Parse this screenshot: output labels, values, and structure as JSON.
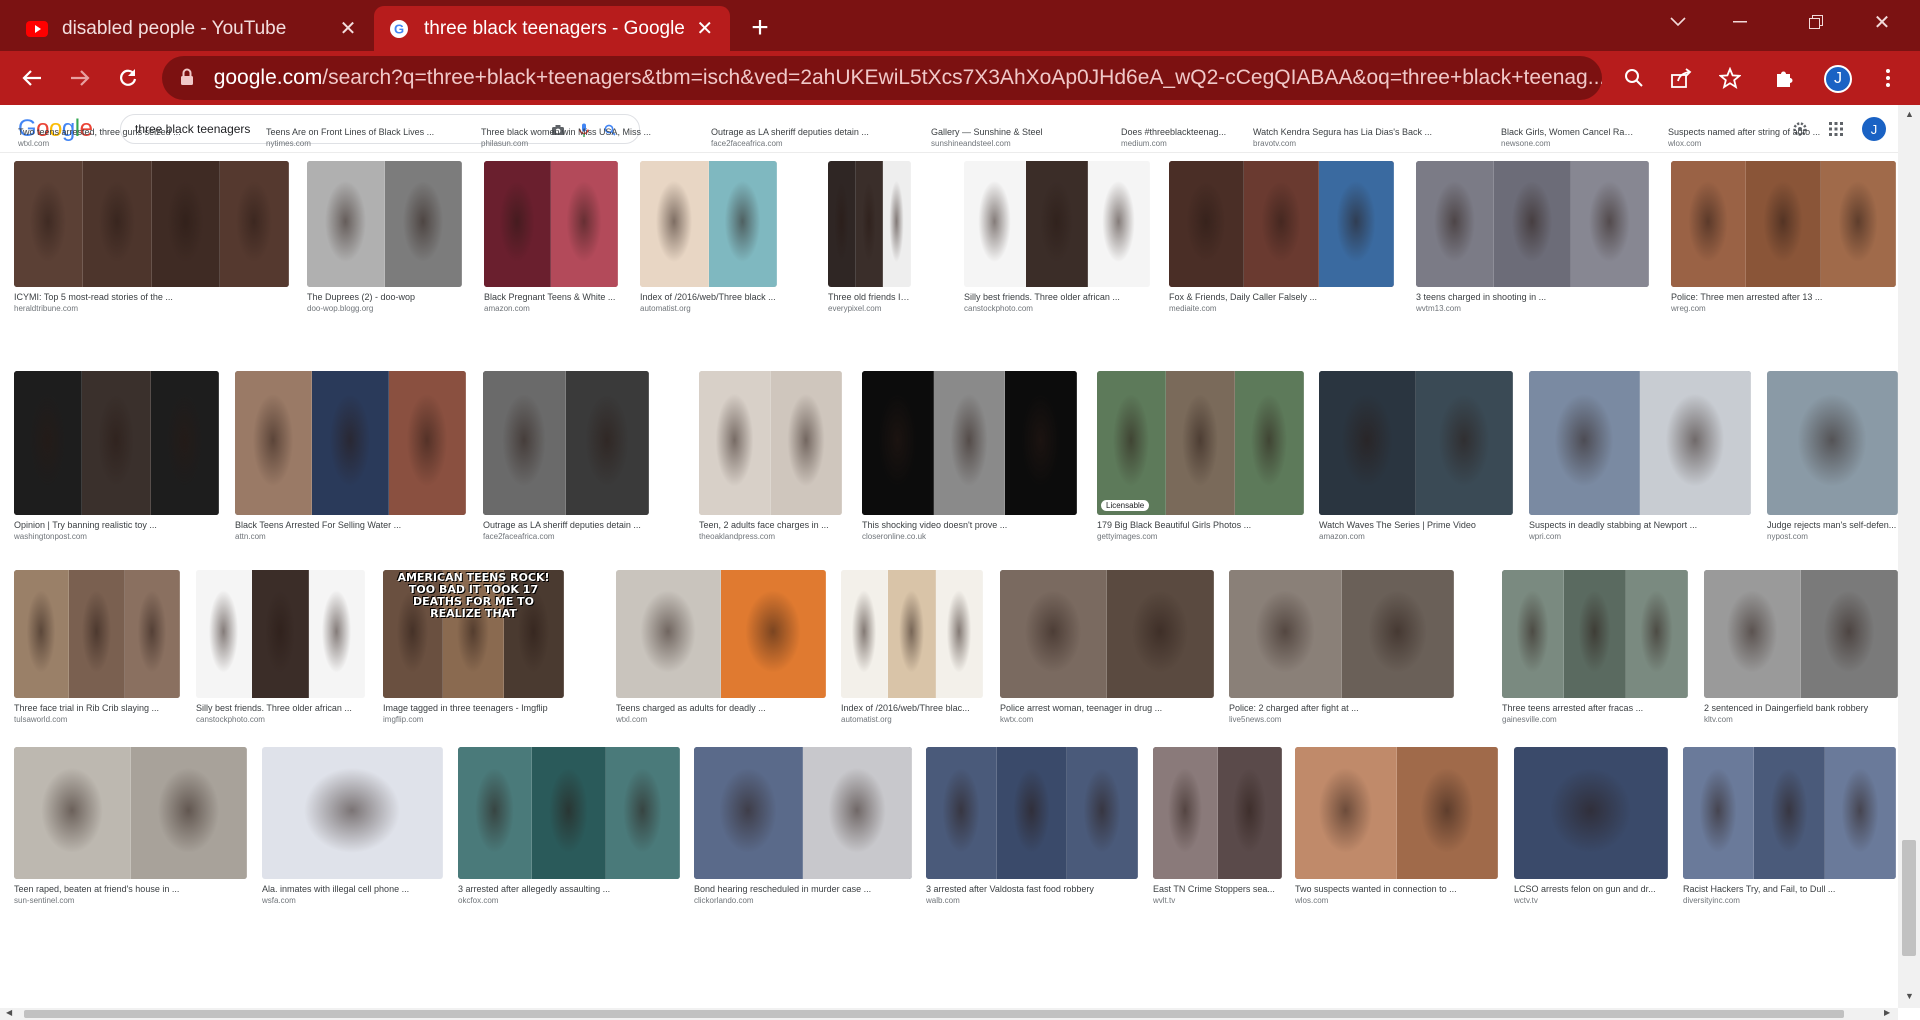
{
  "browser": {
    "tabs": [
      {
        "title": "disabled people - YouTube",
        "favicon": "youtube-icon",
        "active": false
      },
      {
        "title": "three black teenagers - Google S",
        "favicon": "google-icon",
        "active": true
      }
    ],
    "url_host": "google.com",
    "url_path": "/search?q=three+black+teenagers&tbm=isch&ved=2ahUKEwiL5tXcs7X3AhXoAp0JHd6eA_wQ2-cCegQIABAA&oq=three+black+teenag...",
    "profile_initial": "J",
    "theme_colors": {
      "tabstrip": "#7b1212",
      "toolbar": "#b71c1c",
      "omnibox": "#7c1111"
    }
  },
  "google": {
    "logo": [
      {
        "ch": "G",
        "cls": "b"
      },
      {
        "ch": "o",
        "cls": "r"
      },
      {
        "ch": "o",
        "cls": "y"
      },
      {
        "ch": "g",
        "cls": "b"
      },
      {
        "ch": "l",
        "cls": "g"
      },
      {
        "ch": "e",
        "cls": "r"
      }
    ],
    "query": "three black teenagers",
    "profile_initial": "J"
  },
  "rows": [
    {
      "items": [
        {
          "caption": "Two teens arrested, three guns seized ...",
          "source": "wtxl.com",
          "color": "#7a6a5a"
        },
        {
          "caption": "Teens Are on Front Lines of Black Lives ...",
          "source": "nytimes.com",
          "color": "#5e5248"
        },
        {
          "caption": "Three black women win Miss USA, Miss ...",
          "source": "philasun.com",
          "color": "#6b4a3e"
        },
        {
          "caption": "Outrage as LA sheriff deputies detain ...",
          "source": "face2faceafrica.com",
          "color": "#4a4a4a"
        },
        {
          "caption": "Gallery — Sunshine & Steel",
          "source": "sunshineandsteel.com",
          "color": "#8a7a66"
        },
        {
          "caption": "Does #threeblackteenag...",
          "source": "medium.com",
          "color": "#6a6a6a"
        },
        {
          "caption": "Watch Kendra Segura has Lia Dias's Back ...",
          "source": "bravotv.com",
          "color": "#8c6a58"
        },
        {
          "caption": "Black Girls, Women Cancel Racist ...",
          "source": "newsone.com",
          "color": "#5d4a40"
        },
        {
          "caption": "Suspects named after string of auto ...",
          "source": "wlox.com",
          "color": "#706060"
        }
      ]
    },
    {
      "items": [
        {
          "caption": "ICYMI: Top 5 most-read stories of the ...",
          "source": "heraldtribune.com",
          "color": "#4f3a30",
          "panels": [
            "#5b4035",
            "#4d352c",
            "#3f2b24",
            "#55392f"
          ]
        },
        {
          "caption": "The Duprees (2) - doo-wop",
          "source": "doo-wop.blogg.org",
          "color": "#9a9a9a",
          "panels": [
            "#b0b0b0",
            "#7c7c7c"
          ]
        },
        {
          "caption": "Black Pregnant Teens & White ...",
          "source": "amazon.com",
          "color": "#8b2a3a",
          "panels": [
            "#6a1f2e",
            "#b34a5a"
          ]
        },
        {
          "caption": "Index of /2016/web/Three black ...",
          "source": "automatist.org",
          "color": "#d9c3b0",
          "panels": [
            "#e8d6c4",
            "#7fb8c0"
          ]
        },
        {
          "caption": "Three old friends Images -...",
          "source": "everypixel.com",
          "color": "#eeeeee",
          "panels": [
            "#2f2624",
            "#3a2e2a",
            "#eeeeee"
          ]
        },
        {
          "caption": "Silly best friends. Three older african ...",
          "source": "canstockphoto.com",
          "color": "#f3f3f3",
          "panels": [
            "#f5f5f5",
            "#3b2d28",
            "#f5f5f5"
          ]
        },
        {
          "caption": "Fox & Friends, Daily Caller Falsely ...",
          "source": "mediaite.com",
          "color": "#7a2a2a",
          "panels": [
            "#4a2e26",
            "#6a3a30",
            "#3a6aa0"
          ]
        },
        {
          "caption": "3 teens charged in shooting in ...",
          "source": "wvtm13.com",
          "color": "#6a6a72",
          "panels": [
            "#7b7b86",
            "#6c6c78",
            "#878792"
          ]
        },
        {
          "caption": "Police: Three men arrested after 13 ...",
          "source": "wreg.com",
          "color": "#8a5a40",
          "panels": [
            "#9a6245",
            "#8a5538",
            "#a06a4a"
          ]
        }
      ]
    },
    {
      "items": [
        {
          "caption": "Opinion | Try banning realistic toy ...",
          "source": "washingtonpost.com",
          "color": "#2a2a2a",
          "panels": [
            "#1d1d1d",
            "#3a302c",
            "#1d1d1d"
          ]
        },
        {
          "caption": "Black Teens Arrested For Selling Water ...",
          "source": "attn.com",
          "color": "#6a6a6a",
          "panels": [
            "#9a7a66",
            "#2a3a5a",
            "#8a5040"
          ]
        },
        {
          "caption": "Outrage as LA sheriff deputies detain ...",
          "source": "face2faceafrica.com",
          "color": "#4a4a4a",
          "panels": [
            "#6a6a6a",
            "#3a3a3a"
          ]
        },
        {
          "caption": "Teen, 2 adults face charges in ...",
          "source": "theoaklandpress.com",
          "color": "#c9c0b8",
          "panels": [
            "#d8d0c8",
            "#cfc6bd"
          ]
        },
        {
          "caption": "This shocking video doesn't prove ...",
          "source": "closeronline.co.uk",
          "color": "#111111",
          "panels": [
            "#0c0c0c",
            "#8a8a8a",
            "#0c0c0c"
          ]
        },
        {
          "caption": "179 Big Black Beautiful Girls Photos ...",
          "source": "gettyimages.com",
          "color": "#6b8a6a",
          "panels": [
            "#5d7a5a",
            "#7a6a5a",
            "#5d7a5a"
          ],
          "badge": "Licensable"
        },
        {
          "caption": "Watch Waves The Series | Prime Video",
          "source": "amazon.com",
          "color": "#26333d",
          "panels": [
            "#2a3540",
            "#3a4a55"
          ]
        },
        {
          "caption": "Suspects in deadly stabbing at Newport ...",
          "source": "wpri.com",
          "color": "#6a7a90",
          "panels": [
            "#7a8aa2",
            "#c8ccd2"
          ]
        },
        {
          "caption": "Judge rejects man's self-defen...",
          "source": "nypost.com",
          "color": "#7a8a96",
          "panels": [
            "#8a9aa6"
          ]
        }
      ]
    },
    {
      "items": [
        {
          "caption": "Three face trial in Rib Crib slaying ...",
          "source": "tulsaworld.com",
          "color": "#8a7060",
          "panels": [
            "#9a8068",
            "#7a6050",
            "#8a7060"
          ]
        },
        {
          "caption": "Silly best friends. Three older african ...",
          "source": "canstockphoto.com",
          "color": "#f3f3f3",
          "panels": [
            "#f5f5f5",
            "#3b2d28",
            "#f5f5f5"
          ]
        },
        {
          "caption": "Image tagged in three teenagers - Imgflip",
          "source": "imgflip.com",
          "color": "#5a4a3a",
          "panels": [
            "#6a5040",
            "#8a6a50",
            "#4a3a30"
          ],
          "overlay": "AMERICAN TEENS ROCK! TOO BAD IT TOOK 17 DEATHS FOR ME TO REALIZE THAT"
        },
        {
          "caption": "Teens charged as adults for deadly ...",
          "source": "wtxl.com",
          "color": "#d8d6d2",
          "panels": [
            "#c9c4bd",
            "#e07a30"
          ]
        },
        {
          "caption": "Index of /2016/web/Three blac...",
          "source": "automatist.org",
          "color": "#ececec",
          "panels": [
            "#f3f0ea",
            "#d9c4a8",
            "#f3f0ea"
          ]
        },
        {
          "caption": "Police arrest woman, teenager in drug ...",
          "source": "kwtx.com",
          "color": "#6a5a50",
          "panels": [
            "#7a6a60",
            "#5a4a40"
          ]
        },
        {
          "caption": "Police: 2 charged after fight at ...",
          "source": "live5news.com",
          "color": "#7a7068",
          "panels": [
            "#8a8078",
            "#6a6058"
          ]
        },
        {
          "caption": "Three teens arrested after fracas ...",
          "source": "gainesville.com",
          "color": "#6a7a70",
          "panels": [
            "#7a8a80",
            "#5a6a60",
            "#7a8a80"
          ]
        },
        {
          "caption": "2 sentenced in Daingerfield bank robbery",
          "source": "kltv.com",
          "color": "#8a8a8a",
          "panels": [
            "#9a9a9a",
            "#7a7a7a"
          ]
        }
      ]
    },
    {
      "items": [
        {
          "caption": "Teen raped, beaten at friend's house in ...",
          "source": "sun-sentinel.com",
          "color": "#b0aca6",
          "panels": [
            "#bdb8b0",
            "#a8a29a"
          ]
        },
        {
          "caption": "Ala. inmates with illegal cell phone ...",
          "source": "wsfa.com",
          "color": "#e6e8ee",
          "panels": [
            "#dfe2ea"
          ]
        },
        {
          "caption": "3 arrested after allegedly assaulting ...",
          "source": "okcfox.com",
          "color": "#3a6a6a",
          "panels": [
            "#4a7a7a",
            "#2a5a5a",
            "#4a7a7a"
          ]
        },
        {
          "caption": "Bond hearing rescheduled in murder case ...",
          "source": "clickorlando.com",
          "color": "#4a5a7a",
          "panels": [
            "#5a6a8a",
            "#c8c8cc"
          ]
        },
        {
          "caption": "3 arrested after Valdosta fast food robbery",
          "source": "walb.com",
          "color": "#3a4a6a",
          "panels": [
            "#4a5a7a",
            "#3a4a6a",
            "#4a5a7a"
          ]
        },
        {
          "caption": "East TN Crime Stoppers sea...",
          "source": "wvlt.tv",
          "color": "#6a5a5a",
          "panels": [
            "#8a7a7a",
            "#5a4a4a"
          ]
        },
        {
          "caption": "Two suspects wanted in connection to ...",
          "source": "wlos.com",
          "color": "#b07a5a",
          "panels": [
            "#c08a6a",
            "#a06a4a"
          ]
        },
        {
          "caption": "LCSO arrests felon on gun and dr...",
          "source": "wctv.tv",
          "color": "#2a3a5a",
          "panels": [
            "#3a4a6a"
          ]
        },
        {
          "caption": "Racist Hackers Try, and Fail, to Dull ...",
          "source": "diversityinc.com",
          "color": "#5a6a8a",
          "panels": [
            "#6a7a9a",
            "#4a5a7a",
            "#6a7a9a"
          ]
        }
      ]
    }
  ]
}
